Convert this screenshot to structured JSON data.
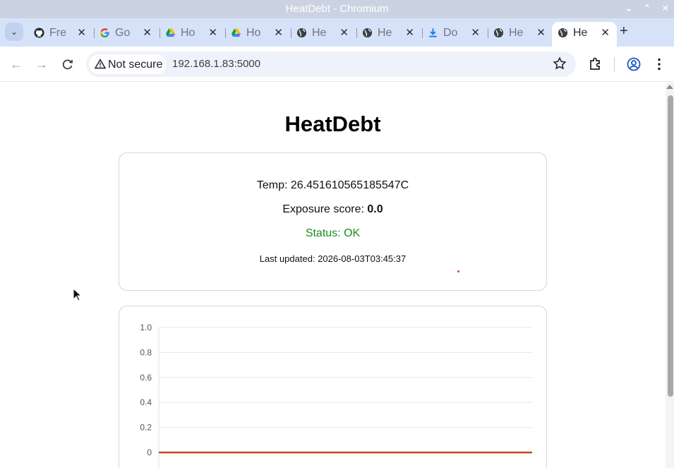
{
  "window": {
    "title": "HeatDebt - Chromium"
  },
  "tabs": [
    {
      "label": "Fre",
      "icon": "github-icon"
    },
    {
      "label": "Go",
      "icon": "google-icon"
    },
    {
      "label": "Ho",
      "icon": "google-drive-icon"
    },
    {
      "label": "Ho",
      "icon": "google-drive-icon"
    },
    {
      "label": "He",
      "icon": "globe-icon"
    },
    {
      "label": "He",
      "icon": "globe-icon"
    },
    {
      "label": "Do",
      "icon": "download-icon"
    },
    {
      "label": "He",
      "icon": "globe-icon"
    },
    {
      "label": "He",
      "icon": "globe-icon",
      "active": true
    }
  ],
  "toolbar": {
    "security_label": "Not secure",
    "url": "192.168.1.83:5000"
  },
  "page": {
    "title": "HeatDebt",
    "temp_label": "Temp:",
    "temp_value": "26.451610565185547C",
    "exposure_label": "Exposure score:",
    "exposure_value": "0.0",
    "status": "Status: OK",
    "last_updated_label": "Last updated:",
    "last_updated_value": "2026-08-03T03:45:37"
  },
  "colors": {
    "status_ok": "#1e8a1e",
    "series_line": "#c6461f"
  },
  "chart_data": {
    "type": "line",
    "y_ticks": [
      "1.0",
      "0.8",
      "0.6",
      "0.4",
      "0.2",
      "0"
    ],
    "ylim": [
      0,
      1.0
    ],
    "grid": true,
    "series": [
      {
        "values": [
          0,
          0
        ]
      }
    ]
  }
}
